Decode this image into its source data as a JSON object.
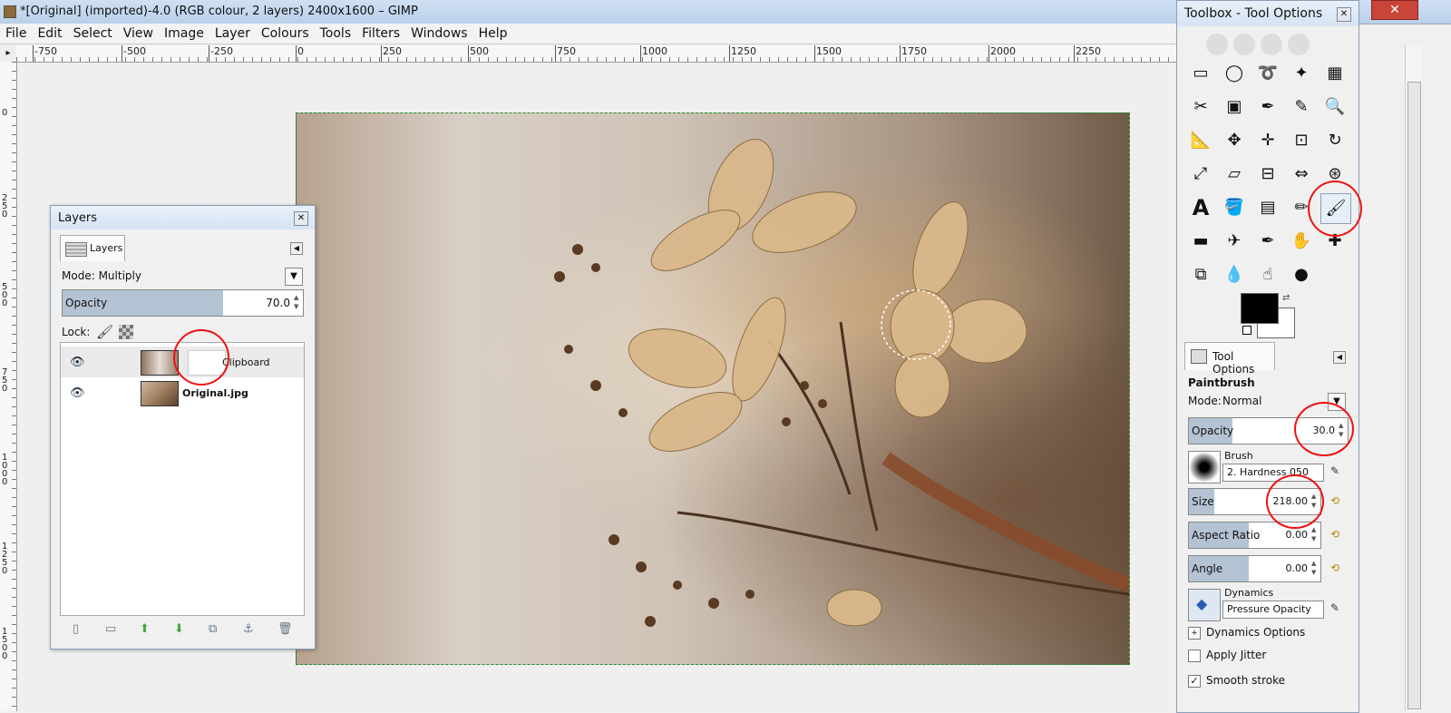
{
  "window": {
    "title": "*[Original] (imported)-4.0 (RGB colour, 2 layers) 2400x1600 – GIMP"
  },
  "menubar": [
    "File",
    "Edit",
    "Select",
    "View",
    "Image",
    "Layer",
    "Colours",
    "Tools",
    "Filters",
    "Windows",
    "Help"
  ],
  "hruler": [
    "-750",
    "-500",
    "-250",
    "0",
    "250",
    "500",
    "750",
    "1000",
    "1250",
    "1500",
    "1750",
    "2000",
    "2250"
  ],
  "vruler": [
    "0",
    "250",
    "500",
    "750",
    "1000",
    "1250",
    "1500"
  ],
  "layers_dialog": {
    "title": "Layers",
    "tab_label": "Layers",
    "mode_label": "Mode:",
    "mode_value": "Multiply",
    "opacity_label": "Opacity",
    "opacity_value": "70.0",
    "opacity_percent": 70,
    "lock_label": "Lock:",
    "layers": [
      {
        "name": "Clipboard",
        "visible": true,
        "bold": false,
        "selected": true
      },
      {
        "name": "Original.jpg",
        "visible": true,
        "bold": true,
        "selected": false
      }
    ]
  },
  "toolbox": {
    "title": "Toolbox - Tool Options",
    "tools": [
      "rect-select-icon",
      "ellipse-select-icon",
      "free-select-icon",
      "fuzzy-select-icon",
      "color-select-icon",
      "scissors-icon",
      "foreground-select-icon",
      "paths-icon",
      "color-picker-icon",
      "zoom-icon",
      "measure-icon",
      "move-icon",
      "align-icon",
      "crop-icon",
      "rotate-icon",
      "scale-icon",
      "shear-icon",
      "perspective-icon",
      "flip-icon",
      "cage-icon",
      "text-icon",
      "bucket-fill-icon",
      "blend-icon",
      "pencil-icon",
      "paintbrush-icon",
      "eraser-icon",
      "airbrush-icon",
      "ink-icon",
      "clone-icon",
      "heal-icon",
      "perspective-clone-icon",
      "blur-icon",
      "smudge-icon",
      "dodge-burn-icon"
    ],
    "fg_color": "#000000",
    "bg_color": "#ffffff",
    "tool_options_tab": "Tool Options",
    "tool_name": "Paintbrush",
    "mode_label": "Mode:",
    "mode_value": "Normal",
    "opacity_label": "Opacity",
    "opacity_value": "30.0",
    "brush_label": "Brush",
    "brush_value": "2. Hardness 050",
    "size_label": "Size",
    "size_value": "218.00",
    "aspect_label": "Aspect Ratio",
    "aspect_value": "0.00",
    "angle_label": "Angle",
    "angle_value": "0.00",
    "dynamics_label": "Dynamics",
    "dynamics_value": "Pressure Opacity",
    "dynamics_options_label": "Dynamics Options",
    "apply_jitter_label": "Apply Jitter",
    "smooth_stroke_label": "Smooth stroke"
  },
  "colors": {
    "selection_border": "#1d8f2b",
    "highlight_circle": "#ee1111",
    "slider_fill": "#b4c3d3"
  }
}
